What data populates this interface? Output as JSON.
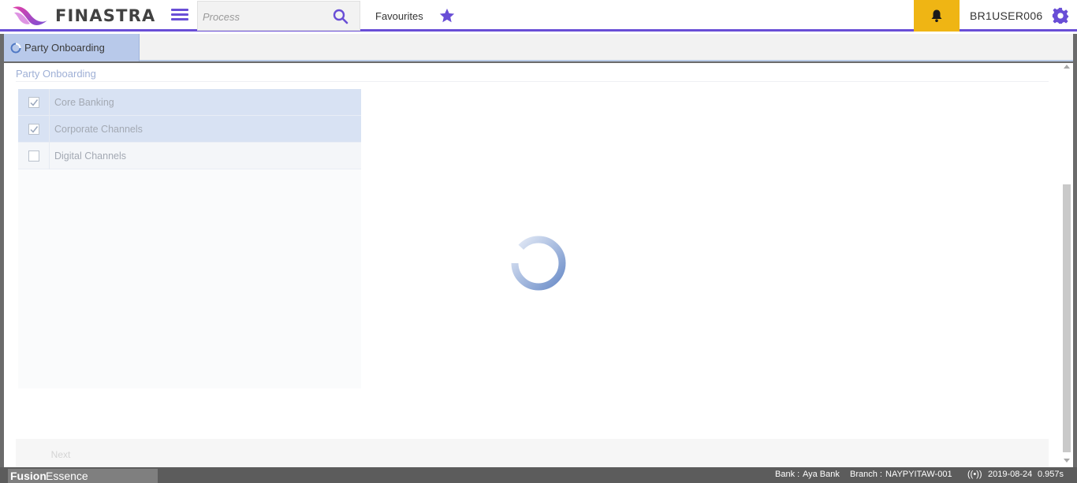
{
  "header": {
    "logo_text": "FINASTRA",
    "search_placeholder": "Process",
    "favourites_label": "Favourites",
    "username": "BR1USER006"
  },
  "tabs": [
    {
      "label": "Party Onboarding",
      "active": true
    }
  ],
  "main": {
    "section_title": "Party Onboarding",
    "items": [
      {
        "label": "Core Banking",
        "checked": true
      },
      {
        "label": "Corporate Channels",
        "checked": true
      },
      {
        "label": "Digital Channels",
        "checked": false
      }
    ],
    "next_label": "Next"
  },
  "statusbar": {
    "brand_bold": "Fusion",
    "brand_light": "Essence",
    "bank_label": "Bank :",
    "bank_value": "Aya Bank",
    "branch_label": "Branch :",
    "branch_value": "NAYPYITAW-001",
    "signal_glyph": "((•))",
    "date": "2019-08-24",
    "timing": "0.957s"
  },
  "colors": {
    "accent": "#694ed6",
    "bell_bg": "#efb514",
    "tab_active": "#b8c9ea",
    "selected_row": "#d8e2f3"
  },
  "icons": [
    "menu-icon",
    "search-icon",
    "star-icon",
    "bell-icon",
    "gear-icon",
    "spinner-icon",
    "checkmark-icon",
    "signal-icon"
  ]
}
